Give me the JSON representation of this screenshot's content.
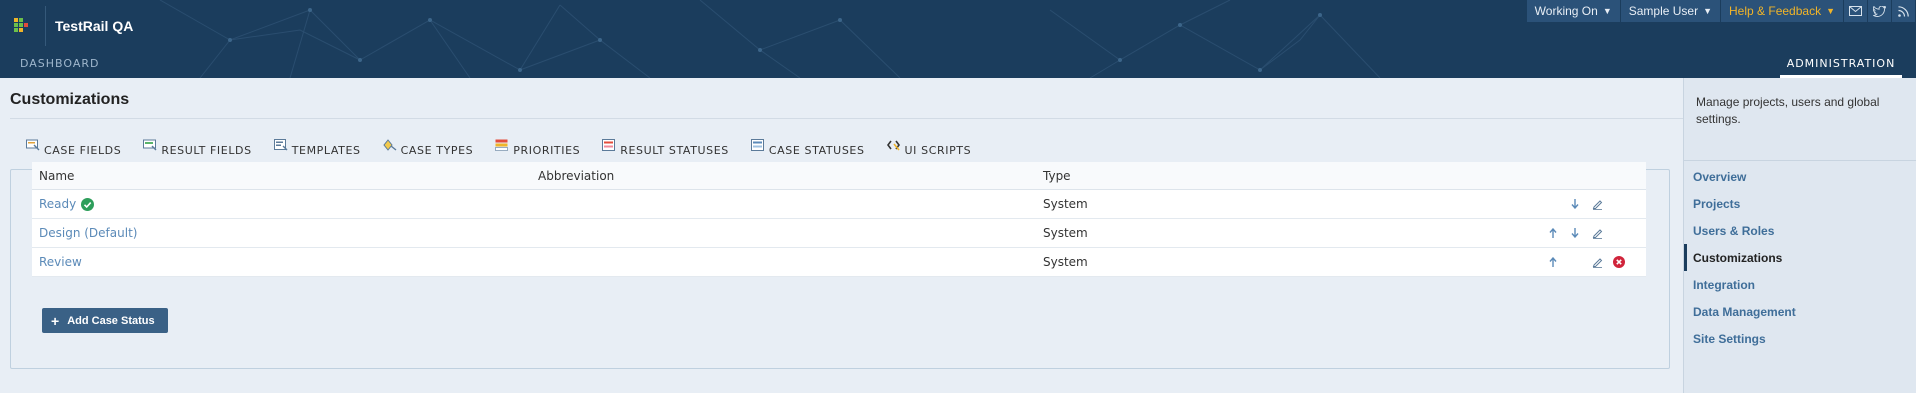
{
  "app": {
    "name": "TestRail QA"
  },
  "topbar": {
    "working_on": "Working On",
    "user": "Sample User",
    "help": "Help & Feedback",
    "icons": [
      "mail-icon",
      "twitter-icon",
      "rss-icon"
    ]
  },
  "nav": {
    "dashboard": "DASHBOARD",
    "administration": "ADMINISTRATION"
  },
  "page": {
    "title": "Customizations"
  },
  "tabs": [
    {
      "label": "CASE FIELDS",
      "icon": "case-fields-icon"
    },
    {
      "label": "RESULT FIELDS",
      "icon": "result-fields-icon"
    },
    {
      "label": "TEMPLATES",
      "icon": "templates-icon"
    },
    {
      "label": "CASE TYPES",
      "icon": "case-types-icon"
    },
    {
      "label": "PRIORITIES",
      "icon": "priorities-icon"
    },
    {
      "label": "RESULT STATUSES",
      "icon": "result-statuses-icon"
    },
    {
      "label": "CASE STATUSES",
      "icon": "case-statuses-icon",
      "active": true
    },
    {
      "label": "UI SCRIPTS",
      "icon": "ui-scripts-icon"
    }
  ],
  "table": {
    "columns": {
      "name": "Name",
      "abbreviation": "Abbreviation",
      "type": "Type"
    },
    "rows": [
      {
        "name": "Ready",
        "abbreviation": "",
        "type": "System",
        "approved": true,
        "actions": [
          "move-down",
          "edit"
        ]
      },
      {
        "name": "Design (Default)",
        "abbreviation": "",
        "type": "System",
        "actions": [
          "move-up",
          "move-down",
          "edit"
        ]
      },
      {
        "name": "Review",
        "abbreviation": "",
        "type": "System",
        "actions": [
          "move-up",
          "edit",
          "delete"
        ]
      }
    ]
  },
  "add_button": {
    "label": "Add Case Status"
  },
  "sidebar": {
    "intro": "Manage projects, users and global settings.",
    "items": [
      {
        "label": "Overview"
      },
      {
        "label": "Projects"
      },
      {
        "label": "Users & Roles"
      },
      {
        "label": "Customizations",
        "active": true
      },
      {
        "label": "Integration"
      },
      {
        "label": "Data Management"
      },
      {
        "label": "Site Settings"
      }
    ]
  },
  "colors": {
    "header_bg": "#1b3d5d",
    "topbar_bg": "#2b5279",
    "help_accent": "#f0b429",
    "link": "#5b8ab8",
    "button_bg": "#3a6186",
    "approved_green": "#2e9e5b",
    "delete_red": "#d0243b"
  }
}
